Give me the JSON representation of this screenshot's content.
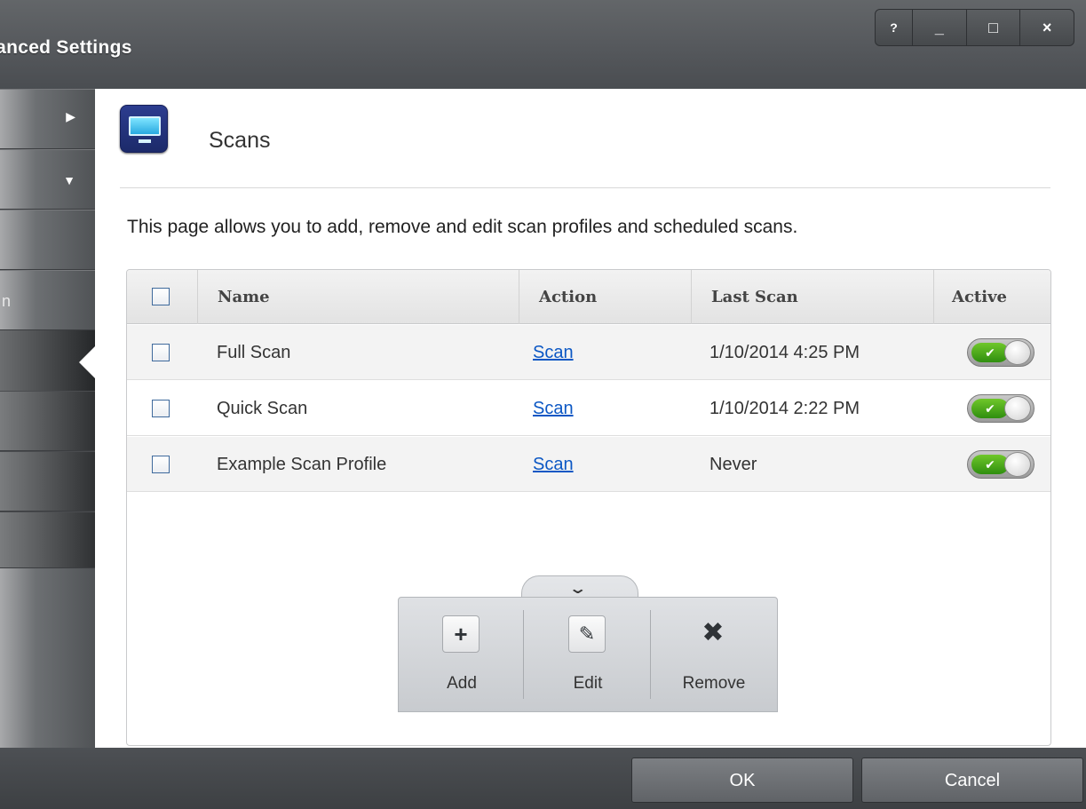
{
  "window": {
    "title": "dvanced Settings",
    "controls": {
      "help": "?",
      "minimize": "_",
      "maximize": "□",
      "close": "×"
    }
  },
  "sidebar": {
    "partial_label": "n"
  },
  "page": {
    "icon": "monitor-scan-icon",
    "title": "Scans",
    "description": "This page allows you to add, remove and edit scan profiles and scheduled scans."
  },
  "table": {
    "headers": {
      "name": "Name",
      "action": "Action",
      "last_scan": "Last Scan",
      "active": "Active"
    },
    "rows": [
      {
        "name": "Full Scan",
        "action": "Scan",
        "last_scan": "1/10/2014 4:25 PM",
        "active": true
      },
      {
        "name": "Quick Scan",
        "action": "Scan",
        "last_scan": "1/10/2014 2:22 PM",
        "active": true
      },
      {
        "name": "Example Scan Profile",
        "action": "Scan",
        "last_scan": "Never",
        "active": true
      }
    ]
  },
  "toolbar": {
    "add": {
      "label": "Add",
      "icon": "plus-icon"
    },
    "edit": {
      "label": "Edit",
      "icon": "pencil-icon"
    },
    "remove": {
      "label": "Remove",
      "icon": "x-icon"
    }
  },
  "footer": {
    "ok": "OK",
    "cancel": "Cancel"
  },
  "colors": {
    "toggle_on": "#3fa81a",
    "link": "#0b57c4",
    "frame": "#4a4d52"
  }
}
